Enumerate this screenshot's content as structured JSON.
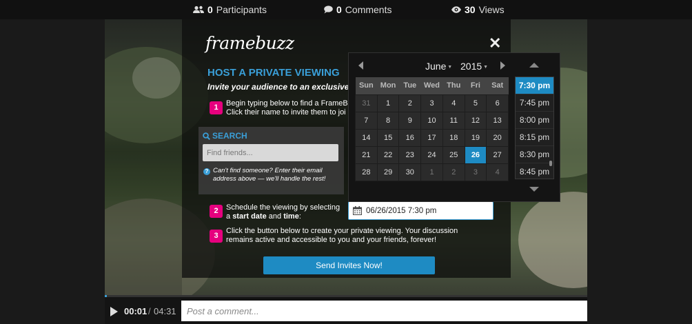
{
  "stats": {
    "participants": {
      "count": "0",
      "label": "Participants",
      "icon": "users-icon"
    },
    "comments": {
      "count": "0",
      "label": "Comments",
      "icon": "comment-icon"
    },
    "views": {
      "count": "30",
      "label": "Views",
      "icon": "eye-icon"
    }
  },
  "modal": {
    "logo": "framebuzz",
    "close": "✕",
    "heading": "HOST A PRIVATE VIEWING",
    "intro": "Invite your audience to an exclusive, liv",
    "step1": {
      "num": "1",
      "line1": "Begin typing below to find a FrameB",
      "line2": "Click their name to invite them to joi"
    },
    "search": {
      "label": "SEARCH",
      "placeholder": "Find friends...",
      "help": "Can't find someone? Enter their email address above — we'll handle the rest!"
    },
    "step2": {
      "num": "2",
      "line1": "Schedule the viewing by selecting",
      "prefix": "a ",
      "bold1": "start date",
      "mid": " and ",
      "bold2": "time",
      "suffix": ":"
    },
    "step3": {
      "num": "3",
      "line1": "Click the button below to create your private viewing. Your discussion",
      "line2": "remains active and accessible to you and your friends, forever!"
    },
    "date_value": "06/26/2015 7:30 pm",
    "send_label": "Send Invites Now!"
  },
  "picker": {
    "month": "June",
    "year": "2015",
    "weekdays": [
      "Sun",
      "Mon",
      "Tue",
      "Wed",
      "Thu",
      "Fri",
      "Sat"
    ],
    "weeks": [
      [
        "31",
        "1",
        "2",
        "3",
        "4",
        "5",
        "6"
      ],
      [
        "7",
        "8",
        "9",
        "10",
        "11",
        "12",
        "13"
      ],
      [
        "14",
        "15",
        "16",
        "17",
        "18",
        "19",
        "20"
      ],
      [
        "21",
        "22",
        "23",
        "24",
        "25",
        "26",
        "27"
      ],
      [
        "28",
        "29",
        "30",
        "1",
        "2",
        "3",
        "4"
      ]
    ],
    "muted_days": [
      "0-0",
      "4-3",
      "4-4",
      "4-5",
      "4-6"
    ],
    "selected_day": "26",
    "times": [
      "7:30 pm",
      "7:45 pm",
      "8:00 pm",
      "8:15 pm",
      "8:30 pm",
      "8:45 pm"
    ],
    "selected_time": "7:30 pm"
  },
  "player": {
    "current": "00:01",
    "separator": "/",
    "total": "04:31",
    "progress_fraction": 0.004,
    "comment_placeholder": "Post a comment..."
  },
  "colors": {
    "accent": "#1e8bc3",
    "heading_blue": "#3a9fd8",
    "step_pink": "#e6007e"
  }
}
